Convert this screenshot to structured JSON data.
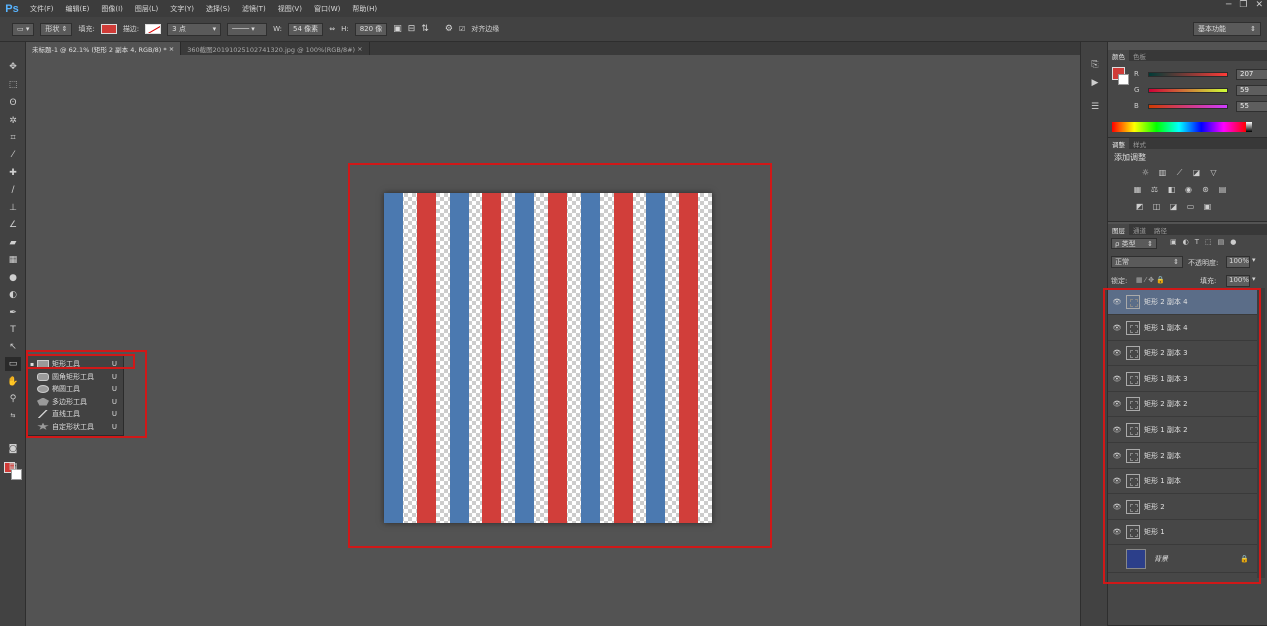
{
  "app": {
    "logo": "Ps"
  },
  "menu": [
    "文件(F)",
    "编辑(E)",
    "图像(I)",
    "图层(L)",
    "文字(Y)",
    "选择(S)",
    "滤镜(T)",
    "视图(V)",
    "窗口(W)",
    "帮助(H)"
  ],
  "window_controls": {
    "minimize": "─",
    "restore": "❐",
    "close": "✕"
  },
  "options": {
    "mode": "形状",
    "fill_label": "填充:",
    "stroke_label": "描边:",
    "stroke_width": "3 点",
    "w_label": "W:",
    "w_value": "54 像素",
    "link": "⇔",
    "h_label": "H:",
    "h_value": "820 像",
    "align_edges": "对齐边缘",
    "workspace": "基本功能"
  },
  "tabs": [
    {
      "label": "未标题-1 @ 62.1% (矩形 2 副本 4, RGB/8) *"
    },
    {
      "label": "360截图20191025102741320.jpg @ 100%(RGB/8#)"
    }
  ],
  "tab_close": "×",
  "canvas": {
    "stripes": [
      {
        "color": "#4b79b0"
      },
      {
        "color": "#d13e3a"
      },
      {
        "color": "#4b79b0"
      },
      {
        "color": "#d13e3a"
      },
      {
        "color": "#4b79b0"
      },
      {
        "color": "#d13e3a"
      },
      {
        "color": "#4b79b0"
      },
      {
        "color": "#d13e3a"
      },
      {
        "color": "#4b79b0"
      },
      {
        "color": "#d13e3a"
      }
    ]
  },
  "shape_menu": [
    {
      "label": "矩形工具",
      "key": "U",
      "icon": "rectangle-icon",
      "selected": true
    },
    {
      "label": "圆角矩形工具",
      "key": "U",
      "icon": "rounded-rectangle-icon"
    },
    {
      "label": "椭圆工具",
      "key": "U",
      "icon": "ellipse-icon"
    },
    {
      "label": "多边形工具",
      "key": "U",
      "icon": "polygon-icon"
    },
    {
      "label": "直线工具",
      "key": "U",
      "icon": "line-icon"
    },
    {
      "label": "自定形状工具",
      "key": "U",
      "icon": "custom-shape-icon"
    }
  ],
  "color_panel": {
    "tabs": [
      "颜色",
      "色板"
    ],
    "r_label": "R",
    "r_value": "207",
    "g_label": "G",
    "g_value": "59",
    "b_label": "B",
    "b_value": "55",
    "foreground": "#cf3b37"
  },
  "adjust_panel": {
    "tabs": [
      "调整",
      "样式"
    ],
    "title": "添加调整"
  },
  "layers_panel": {
    "tabs": [
      "图层",
      "通道",
      "路径"
    ],
    "filter": "ρ 类型",
    "blend_mode": "正常",
    "opacity_label": "不透明度:",
    "opacity_value": "100%",
    "lock_label": "锁定:",
    "fill_label": "填充:",
    "fill_value": "100%",
    "layers": [
      {
        "name": "矩形 2 副本 4",
        "selected": true
      },
      {
        "name": "矩形 1 副本 4"
      },
      {
        "name": "矩形 2 副本 3"
      },
      {
        "name": "矩形 1 副本 3"
      },
      {
        "name": "矩形 2 副本 2"
      },
      {
        "name": "矩形 1 副本 2"
      },
      {
        "name": "矩形 2 副本"
      },
      {
        "name": "矩形 1 副本"
      },
      {
        "name": "矩形 2"
      },
      {
        "name": "矩形 1"
      }
    ],
    "background_layer": {
      "name": "背景",
      "color": "#2c3f8a"
    }
  }
}
